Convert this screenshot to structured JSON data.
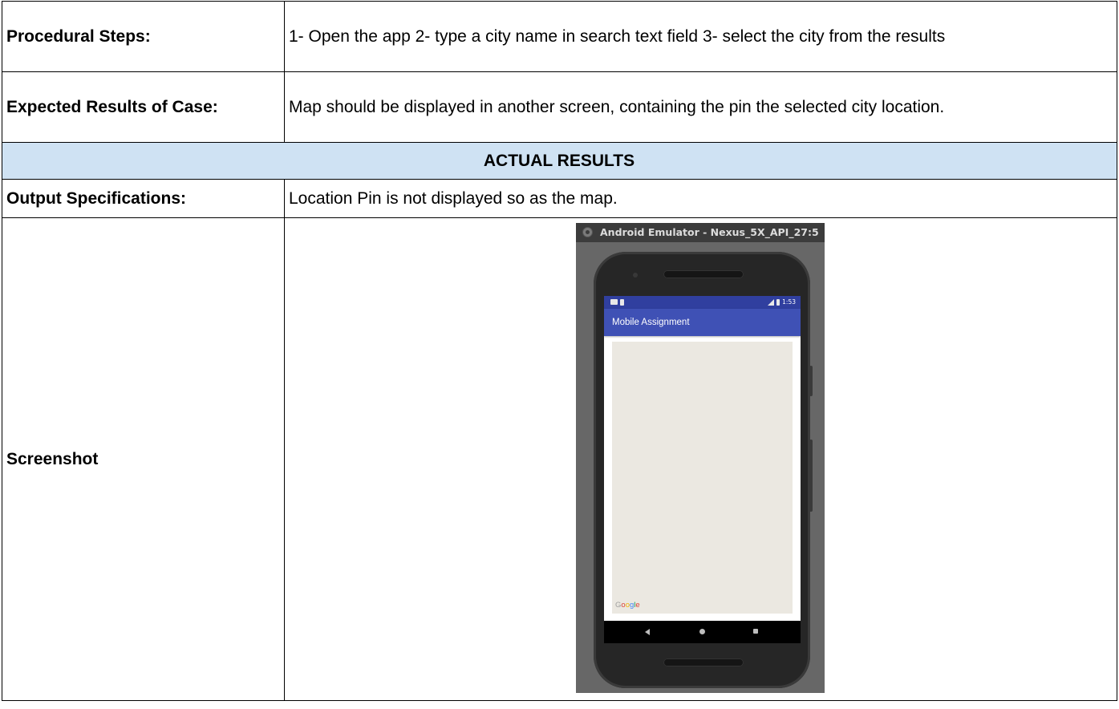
{
  "rows": {
    "procedural": {
      "label": "Procedural Steps:",
      "value": "1- Open the app 2- type a city name in search text field 3- select the city from the results"
    },
    "expected": {
      "label": "Expected Results of Case:",
      "value": "Map should be displayed in another screen, containing the pin the selected city location."
    },
    "actual_header": "ACTUAL RESULTS",
    "output": {
      "label": "Output Specifications:",
      "value": "Location Pin is not displayed so as the map."
    },
    "screenshot": {
      "label": "Screenshot"
    }
  },
  "emulator": {
    "window_title": "Android Emulator - Nexus_5X_API_27:5",
    "status_time": "1:53",
    "app_title": "Mobile Assignment",
    "map_attribution": "Google",
    "icons": {
      "close": "circle-close-icon",
      "notification_left": "sim-card-icon",
      "signal": "signal-icon",
      "battery": "battery-icon",
      "nav_back": "back-triangle-icon",
      "nav_home": "home-circle-icon",
      "nav_recents": "recents-square-icon"
    }
  },
  "colors": {
    "header_row_background": "#cfe2f3",
    "app_bar": "#3f51b5",
    "status_bar": "#303f9f",
    "map_background": "#ebe8e1"
  }
}
